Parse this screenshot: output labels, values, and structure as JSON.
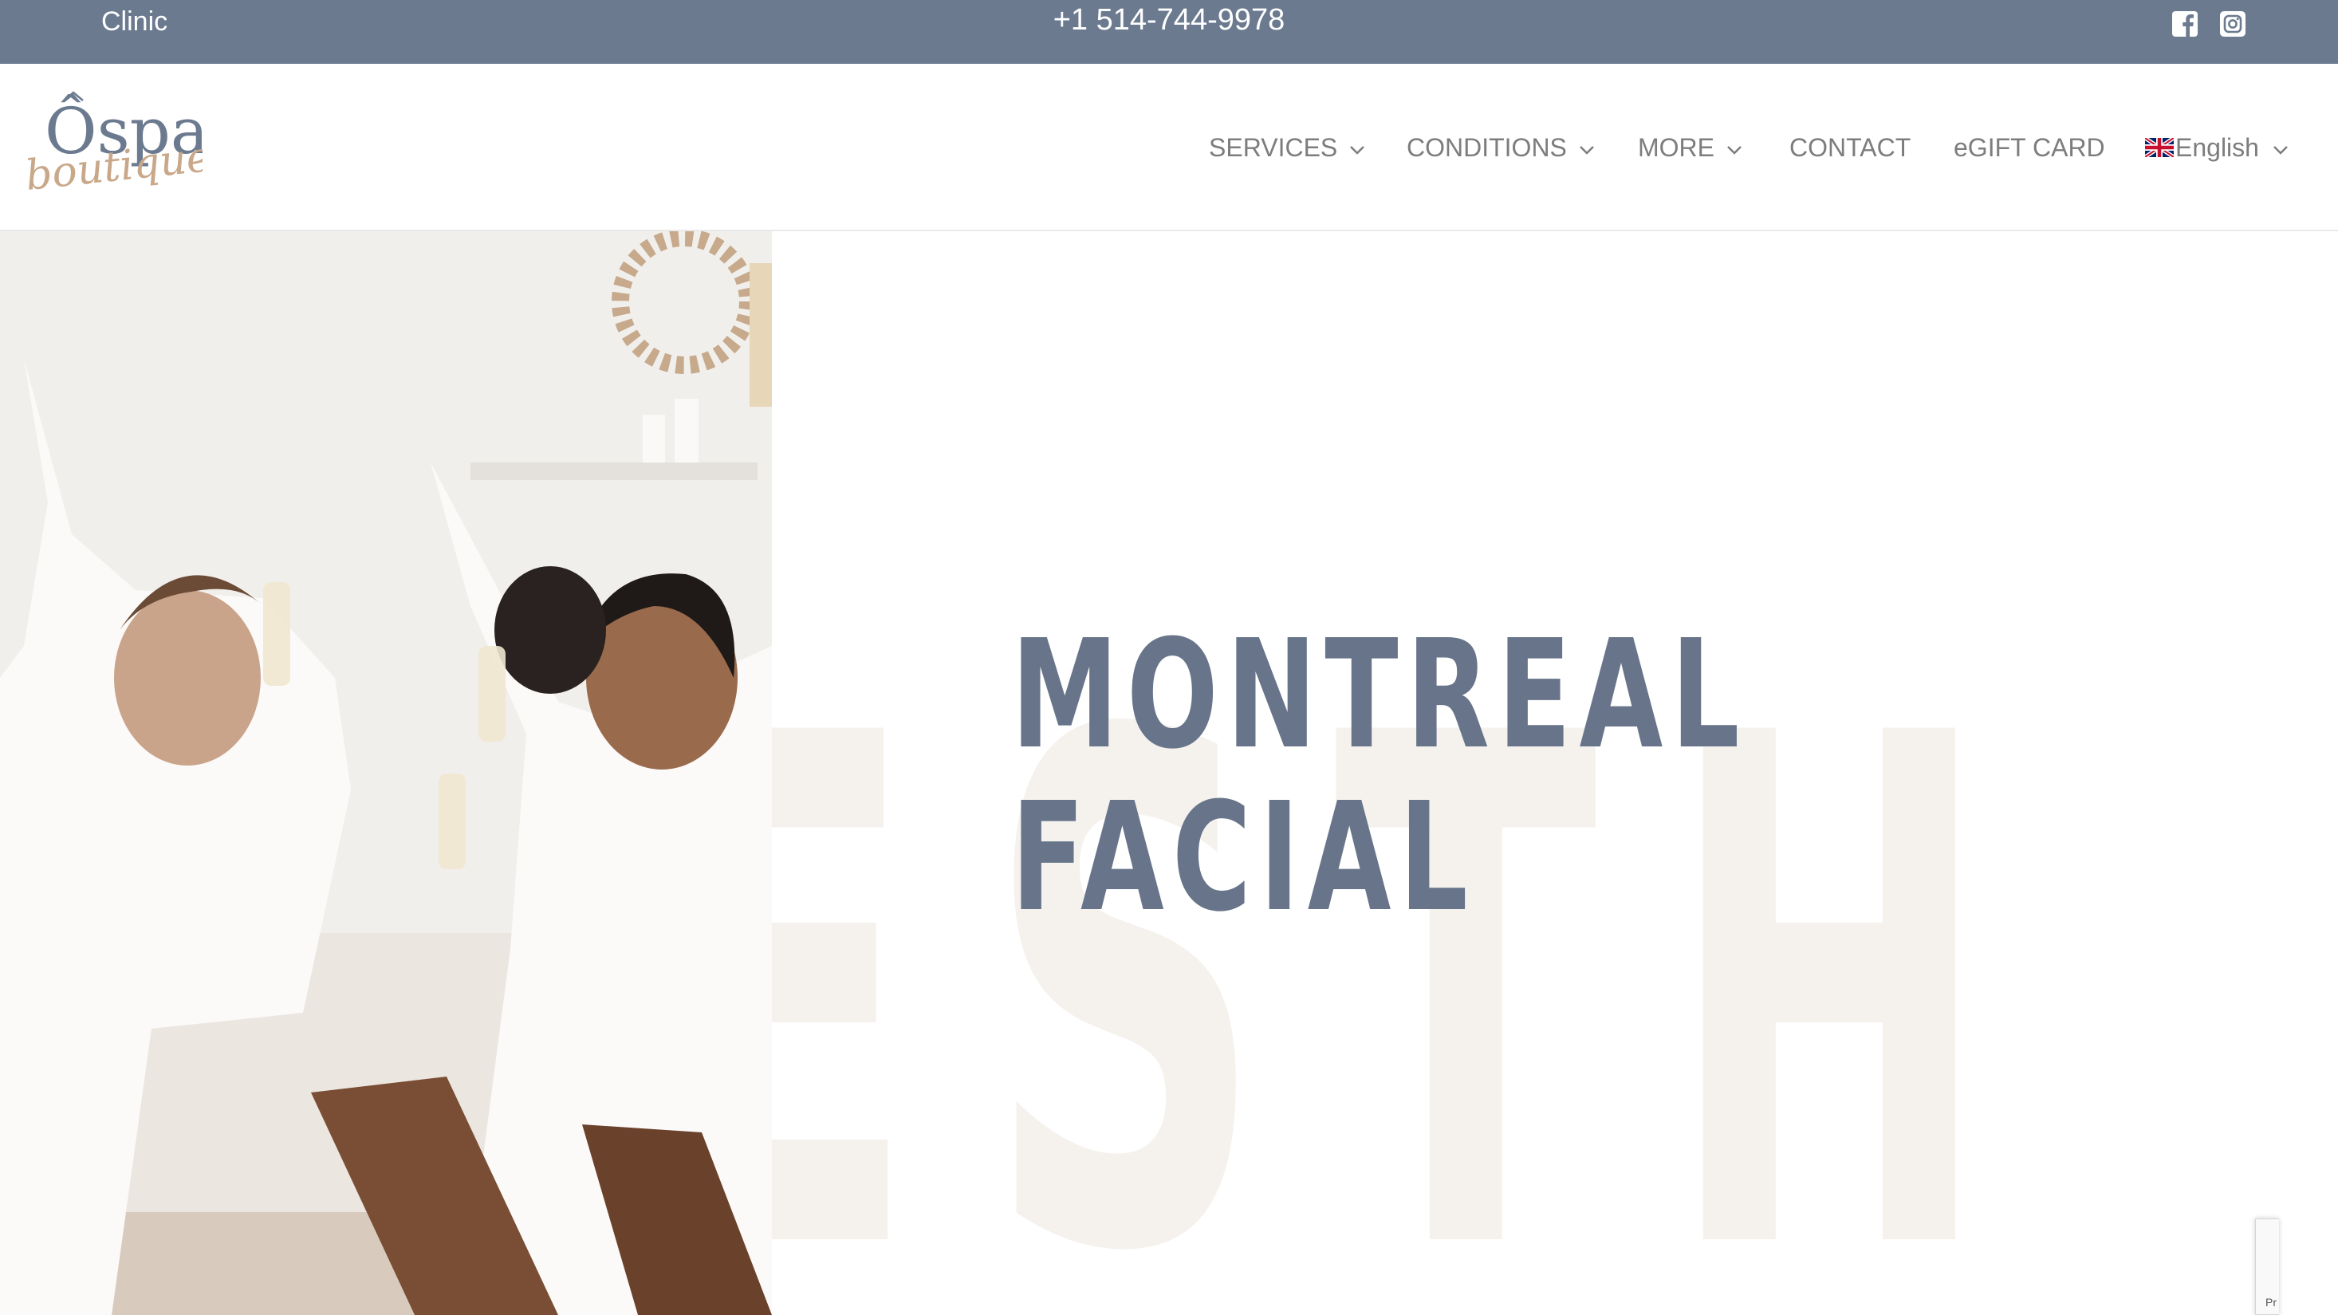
{
  "topbar": {
    "clinic_label": "Clinic",
    "phone": "+1 514-744-9978",
    "social_icons": [
      "facebook-icon",
      "instagram-icon"
    ],
    "bg_color": "#6b7a8f"
  },
  "logo": {
    "line1": "Ôspa",
    "line2": "boutique"
  },
  "nav": {
    "items": [
      {
        "label": "SERVICES",
        "dropdown": true
      },
      {
        "label": "CONDITIONS",
        "dropdown": true
      },
      {
        "label": "MORE",
        "dropdown": true
      },
      {
        "label": "CONTACT",
        "dropdown": false
      },
      {
        "label": "eGIFT CARD",
        "dropdown": false
      },
      {
        "label": "English",
        "dropdown": true,
        "icon": "uk-flag-icon"
      }
    ]
  },
  "hero": {
    "title_line1": "MONTREAL",
    "title_line2": "FACIAL",
    "background_word": "ESTH",
    "title_color": "#677489",
    "background_word_color": "#f5f2ee"
  },
  "recaptcha": {
    "text": "Pr"
  }
}
